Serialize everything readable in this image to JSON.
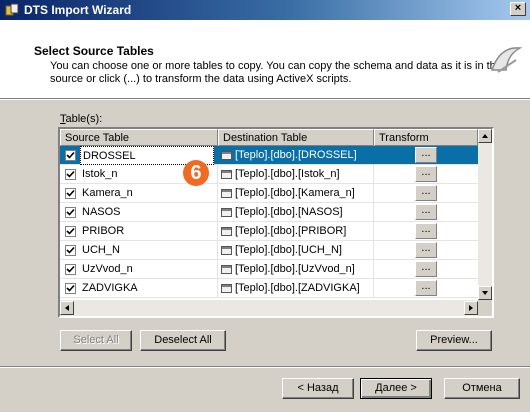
{
  "window": {
    "title": "DTS Import Wizard",
    "close_glyph": "×"
  },
  "header": {
    "title": "Select Source Tables",
    "description": "You can choose one or more tables to copy.  You can copy the schema and data as it is in the source or click (...) to transform the data using ActiveX scripts."
  },
  "tables_label_prefix": "T",
  "tables_label_rest": "able(s):",
  "columns": [
    "Source Table",
    "Destination Table",
    "Transform"
  ],
  "rows": [
    {
      "checked": true,
      "source": "DROSSEL",
      "destination": "[Teplo].[dbo].[DROSSEL]",
      "transform": "...",
      "selected": true
    },
    {
      "checked": true,
      "source": "Istok_n",
      "destination": "[Teplo].[dbo].[Istok_n]",
      "transform": "..."
    },
    {
      "checked": true,
      "source": "Kamera_n",
      "destination": "[Teplo].[dbo].[Kamera_n]",
      "transform": "..."
    },
    {
      "checked": true,
      "source": "NASOS",
      "destination": "[Teplo].[dbo].[NASOS]",
      "transform": "..."
    },
    {
      "checked": true,
      "source": "PRIBOR",
      "destination": "[Teplo].[dbo].[PRIBOR]",
      "transform": "..."
    },
    {
      "checked": true,
      "source": "UCH_N",
      "destination": "[Teplo].[dbo].[UCH_N]",
      "transform": "..."
    },
    {
      "checked": true,
      "source": "UzVvod_n",
      "destination": "[Teplo].[dbo].[UzVvod_n]",
      "transform": "..."
    },
    {
      "checked": true,
      "source": "ZADVIGKA",
      "destination": "[Teplo].[dbo].[ZADVIGKA]",
      "transform": "..."
    }
  ],
  "badge": "6",
  "buttons": {
    "select_all": "Select All",
    "deselect_all": "Deselect All",
    "preview": "Preview...",
    "back": "< Назад",
    "next": "Далее >",
    "cancel": "Отмена"
  },
  "colors": {
    "selection": "#0a6fa6",
    "badge": "#f06a24",
    "face": "#d4d0c8"
  }
}
